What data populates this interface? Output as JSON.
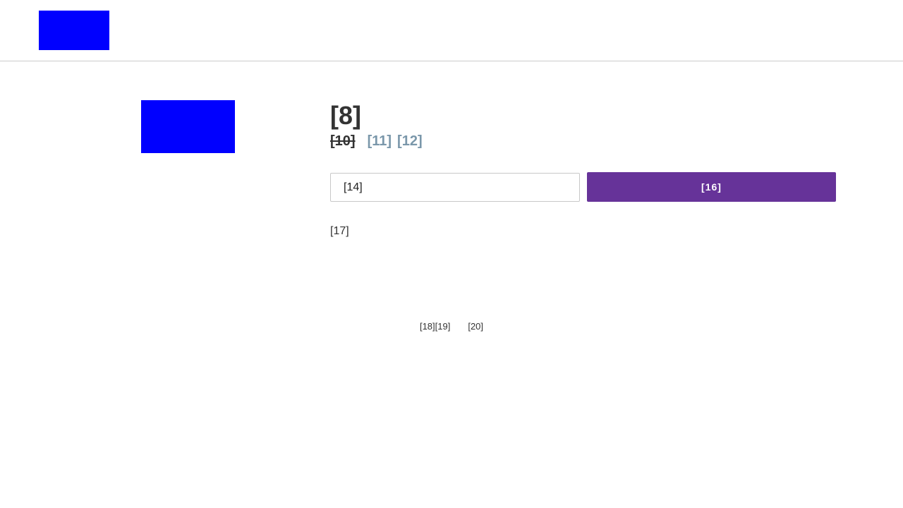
{
  "header": {
    "logo": {
      "color": "#0000ff"
    }
  },
  "product": {
    "image": {
      "color": "#0000ff"
    },
    "title": "[8]",
    "price_old": "[10]",
    "price_new": "[11]",
    "price_unit": "[12]",
    "quantity_value": "[14]",
    "add_button_label": "[16]",
    "description": "[17]"
  },
  "footer": {
    "left_text_a": "[18]",
    "left_text_b": "[19]",
    "right_link": "[20]"
  },
  "colors": {
    "accent": "#663399",
    "muted_price": "#7a97aa",
    "placeholder_block": "#0000ff",
    "divider": "#cccccc"
  }
}
